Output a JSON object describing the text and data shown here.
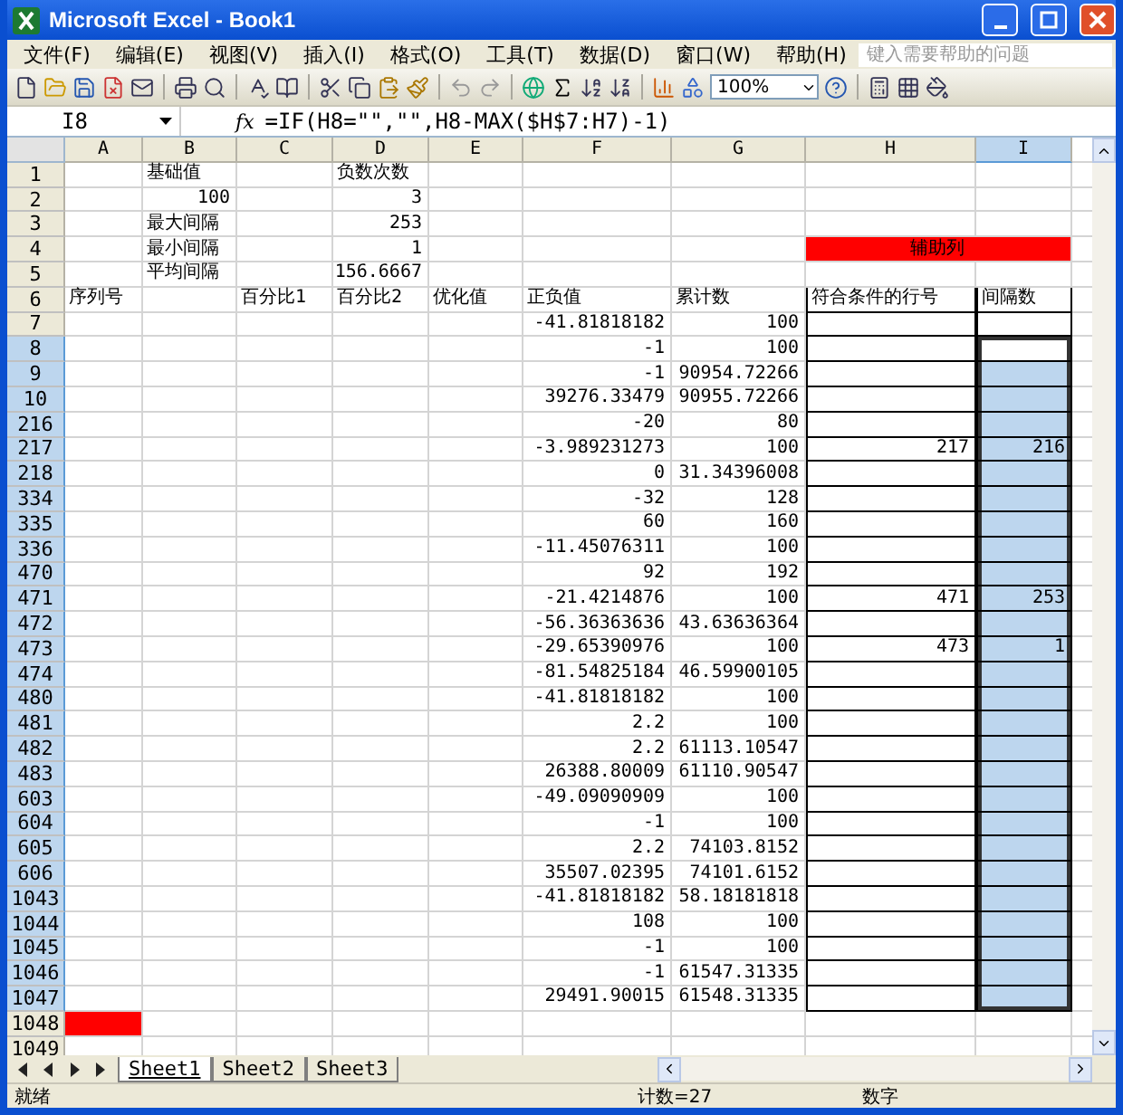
{
  "window": {
    "title": "Microsoft Excel - Book1"
  },
  "menu": [
    "文件(F)",
    "编辑(E)",
    "视图(V)",
    "插入(I)",
    "格式(O)",
    "工具(T)",
    "数据(D)",
    "窗口(W)",
    "帮助(H)"
  ],
  "help_box": {
    "placeholder": "键入需要帮助的问题"
  },
  "toolbar": {
    "zoom": "100%"
  },
  "formula_bar": {
    "name_box": "I8",
    "fx": "fx",
    "formula": "=IF(H8=\"\",\"\",H8-MAX($H$7:H7)-1)"
  },
  "columns": [
    {
      "label": "A",
      "selected": false,
      "boxed": false
    },
    {
      "label": "B",
      "selected": false,
      "boxed": false
    },
    {
      "label": "C",
      "selected": false,
      "boxed": false
    },
    {
      "label": "D",
      "selected": false,
      "boxed": false
    },
    {
      "label": "E",
      "selected": false,
      "boxed": false
    },
    {
      "label": "F",
      "selected": false,
      "boxed": false
    },
    {
      "label": "G",
      "selected": false,
      "boxed": false
    },
    {
      "label": "H",
      "selected": false,
      "boxed": true
    },
    {
      "label": "I",
      "selected": true,
      "boxed": true
    }
  ],
  "rows": [
    {
      "header": "1",
      "selected": false,
      "boxed": false,
      "cells": [
        null,
        "基础值",
        null,
        "负数次数",
        null,
        null,
        null,
        null,
        null
      ]
    },
    {
      "header": "2",
      "selected": false,
      "boxed": false,
      "cells": [
        null,
        "100",
        null,
        "3",
        null,
        null,
        null,
        null,
        null
      ]
    },
    {
      "header": "3",
      "selected": false,
      "boxed": false,
      "cells": [
        null,
        "最大间隔",
        null,
        "253",
        null,
        null,
        null,
        null,
        null
      ]
    },
    {
      "header": "4",
      "selected": false,
      "boxed": false,
      "cells": [
        null,
        "最小间隔",
        null,
        "1",
        null,
        null,
        null,
        {
          "text": "辅助列",
          "color": "#ff0000",
          "merged": true
        },
        null
      ]
    },
    {
      "header": "5",
      "selected": false,
      "boxed": false,
      "cells": [
        null,
        "平均间隔",
        null,
        "156.6667",
        null,
        null,
        null,
        null,
        null
      ]
    },
    {
      "header": "6",
      "selected": false,
      "boxed": true,
      "cells": [
        "序列号",
        null,
        "百分比1",
        "百分比2",
        "优化值",
        "正负值",
        "累计数",
        "符合条件的行号",
        "间隔数"
      ]
    },
    {
      "header": "7",
      "selected": false,
      "boxed": true,
      "cells": [
        null,
        null,
        null,
        null,
        null,
        "-41.81818182",
        "100",
        null,
        null
      ]
    },
    {
      "header": "8",
      "selected": true,
      "boxed": true,
      "cells": [
        null,
        null,
        null,
        null,
        null,
        "-1",
        "100",
        null,
        null
      ]
    },
    {
      "header": "9",
      "selected": true,
      "boxed": true,
      "cells": [
        null,
        null,
        null,
        null,
        null,
        "-1",
        "90954.72266",
        null,
        null
      ]
    },
    {
      "header": "10",
      "selected": true,
      "boxed": true,
      "cells": [
        null,
        null,
        null,
        null,
        null,
        "39276.33479",
        "90955.72266",
        null,
        null
      ]
    },
    {
      "header": "216",
      "selected": true,
      "boxed": true,
      "cells": [
        null,
        null,
        null,
        null,
        null,
        "-20",
        "80",
        null,
        null
      ]
    },
    {
      "header": "217",
      "selected": true,
      "boxed": true,
      "cells": [
        null,
        null,
        null,
        null,
        null,
        "-3.989231273",
        "100",
        "217",
        "216"
      ]
    },
    {
      "header": "218",
      "selected": true,
      "boxed": true,
      "cells": [
        null,
        null,
        null,
        null,
        null,
        "0",
        "31.34396008",
        null,
        null
      ]
    },
    {
      "header": "334",
      "selected": true,
      "boxed": true,
      "cells": [
        null,
        null,
        null,
        null,
        null,
        "-32",
        "128",
        null,
        null
      ]
    },
    {
      "header": "335",
      "selected": true,
      "boxed": true,
      "cells": [
        null,
        null,
        null,
        null,
        null,
        "60",
        "160",
        null,
        null
      ]
    },
    {
      "header": "336",
      "selected": true,
      "boxed": true,
      "cells": [
        null,
        null,
        null,
        null,
        null,
        "-11.45076311",
        "100",
        null,
        null
      ]
    },
    {
      "header": "470",
      "selected": true,
      "boxed": true,
      "cells": [
        null,
        null,
        null,
        null,
        null,
        "92",
        "192",
        null,
        null
      ]
    },
    {
      "header": "471",
      "selected": true,
      "boxed": true,
      "cells": [
        null,
        null,
        null,
        null,
        null,
        "-21.4214876",
        "100",
        "471",
        "253"
      ]
    },
    {
      "header": "472",
      "selected": true,
      "boxed": true,
      "cells": [
        null,
        null,
        null,
        null,
        null,
        "-56.36363636",
        "43.63636364",
        null,
        null
      ]
    },
    {
      "header": "473",
      "selected": true,
      "boxed": true,
      "cells": [
        null,
        null,
        null,
        null,
        null,
        "-29.65390976",
        "100",
        "473",
        "1"
      ]
    },
    {
      "header": "474",
      "selected": true,
      "boxed": true,
      "cells": [
        null,
        null,
        null,
        null,
        null,
        "-81.54825184",
        "46.59900105",
        null,
        null
      ]
    },
    {
      "header": "480",
      "selected": true,
      "boxed": true,
      "cells": [
        null,
        null,
        null,
        null,
        null,
        "-41.81818182",
        "100",
        null,
        null
      ]
    },
    {
      "header": "481",
      "selected": true,
      "boxed": true,
      "cells": [
        null,
        null,
        null,
        null,
        null,
        "2.2",
        "100",
        null,
        null
      ]
    },
    {
      "header": "482",
      "selected": true,
      "boxed": true,
      "cells": [
        null,
        null,
        null,
        null,
        null,
        "2.2",
        "61113.10547",
        null,
        null
      ]
    },
    {
      "header": "483",
      "selected": true,
      "boxed": true,
      "cells": [
        null,
        null,
        null,
        null,
        null,
        "26388.80009",
        "61110.90547",
        null,
        null
      ]
    },
    {
      "header": "603",
      "selected": true,
      "boxed": true,
      "cells": [
        null,
        null,
        null,
        null,
        null,
        "-49.09090909",
        "100",
        null,
        null
      ]
    },
    {
      "header": "604",
      "selected": true,
      "boxed": true,
      "cells": [
        null,
        null,
        null,
        null,
        null,
        "-1",
        "100",
        null,
        null
      ]
    },
    {
      "header": "605",
      "selected": true,
      "boxed": true,
      "cells": [
        null,
        null,
        null,
        null,
        null,
        "2.2",
        "74103.8152",
        null,
        null
      ]
    },
    {
      "header": "606",
      "selected": true,
      "boxed": true,
      "cells": [
        null,
        null,
        null,
        null,
        null,
        "35507.02395",
        "74101.6152",
        null,
        null
      ]
    },
    {
      "header": "1043",
      "selected": true,
      "boxed": true,
      "cells": [
        null,
        null,
        null,
        null,
        null,
        "-41.81818182",
        "58.18181818",
        null,
        null
      ]
    },
    {
      "header": "1044",
      "selected": true,
      "boxed": true,
      "cells": [
        null,
        null,
        null,
        null,
        null,
        "108",
        "100",
        null,
        null
      ]
    },
    {
      "header": "1045",
      "selected": true,
      "boxed": true,
      "cells": [
        null,
        null,
        null,
        null,
        null,
        "-1",
        "100",
        null,
        null
      ]
    },
    {
      "header": "1046",
      "selected": true,
      "boxed": true,
      "cells": [
        null,
        null,
        null,
        null,
        null,
        "-1",
        "61547.31335",
        null,
        null
      ]
    },
    {
      "header": "1047",
      "selected": true,
      "boxed": true,
      "cells": [
        null,
        null,
        null,
        null,
        null,
        "29491.90015",
        "61548.31335",
        null,
        null
      ]
    },
    {
      "header": "1048",
      "selected": false,
      "boxed": false,
      "cells": [
        {
          "color": "#ff0000"
        },
        null,
        null,
        null,
        null,
        null,
        null,
        null,
        null
      ]
    },
    {
      "header": "1049",
      "selected": false,
      "boxed": false,
      "cells": [
        null,
        null,
        null,
        null,
        null,
        null,
        null,
        null,
        null
      ]
    }
  ],
  "sheet_tabs": [
    {
      "label": "Sheet1",
      "selected": true
    },
    {
      "label": "Sheet2",
      "selected": false
    },
    {
      "label": "Sheet3",
      "selected": false
    }
  ],
  "status_bar": {
    "state": "就绪",
    "count": "计数=27",
    "mode": "数字"
  }
}
